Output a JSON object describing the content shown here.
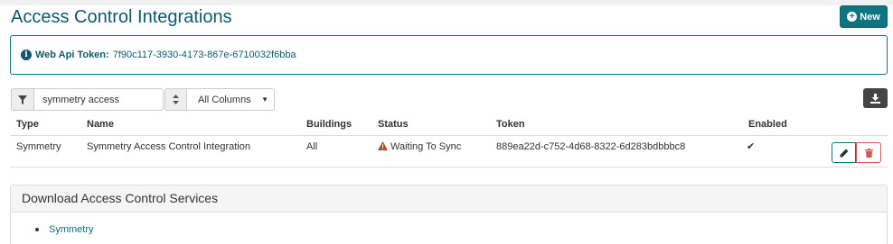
{
  "page": {
    "title": "Access Control Integrations",
    "new_button_label": "New"
  },
  "token_box": {
    "label": "Web Api Token:",
    "value": "7f90c117-3930-4173-867e-6710032f6bba"
  },
  "filter": {
    "search_value": "symmetry access",
    "column_select_value": "All Columns"
  },
  "table": {
    "headers": {
      "type": "Type",
      "name": "Name",
      "buildings": "Buildings",
      "status": "Status",
      "token": "Token",
      "enabled": "Enabled"
    },
    "rows": [
      {
        "type": "Symmetry",
        "name": "Symmetry Access Control Integration",
        "buildings": "All",
        "status": "Waiting To Sync",
        "token": "889ea22d-c752-4d68-8322-6d283bdbbbc8",
        "enabled": "✔"
      }
    ]
  },
  "download_panel": {
    "heading": "Download Access Control Services",
    "links": [
      "Symmetry"
    ]
  },
  "colors": {
    "brand": "#0e7580",
    "title": "#0e5a6b",
    "danger": "#d9534f",
    "warning": "#a94d2a"
  },
  "icons": {
    "new": "plus-circle-icon",
    "info": "info-circle-icon",
    "filter": "filter-icon",
    "sort": "sort-icon",
    "download": "download-icon",
    "warning": "warning-icon",
    "edit": "pencil-icon",
    "delete": "trash-icon",
    "enabled": "check-icon"
  }
}
